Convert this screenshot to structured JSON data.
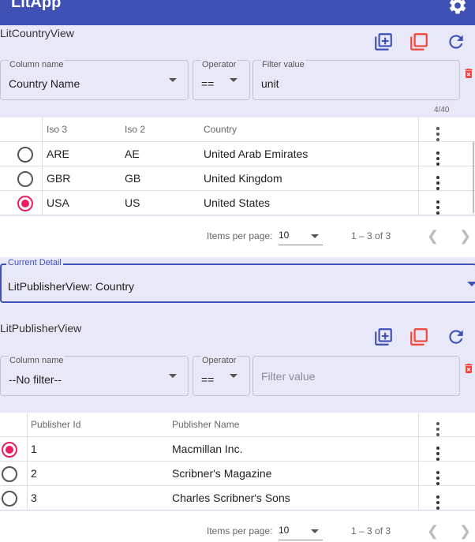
{
  "app": {
    "title": "LitApp"
  },
  "country_view": {
    "title": "LitCountryView",
    "filter": {
      "column_label": "Column name",
      "column_value": "Country Name",
      "operator_label": "Operator",
      "operator_value": "==",
      "value_label": "Filter value",
      "value_value": "unit"
    },
    "count": "4/40",
    "columns": [
      "Iso 3",
      "Iso 2",
      "Country"
    ],
    "rows": [
      {
        "iso3": "ARE",
        "iso2": "AE",
        "country": "United Arab Emirates",
        "selected": false
      },
      {
        "iso3": "GBR",
        "iso2": "GB",
        "country": "United Kingdom",
        "selected": false
      },
      {
        "iso3": "USA",
        "iso2": "US",
        "country": "United States",
        "selected": true
      }
    ],
    "paginator": {
      "items_per_page_label": "Items per page:",
      "items_per_page": "10",
      "range": "1 – 3 of 3"
    }
  },
  "current_detail": {
    "label": "Current Detail",
    "value": "LitPublisherView: Country"
  },
  "publisher_view": {
    "title": "LitPublisherView",
    "filter": {
      "column_label": "Column name",
      "column_value": "--No filter--",
      "operator_label": "Operator",
      "operator_value": "==",
      "value_placeholder": "Filter value"
    },
    "columns": [
      "Publisher Id",
      "Publisher Name"
    ],
    "rows": [
      {
        "id": "1",
        "name": "Macmillan Inc.",
        "selected": true
      },
      {
        "id": "2",
        "name": "Scribner's Magazine",
        "selected": false
      },
      {
        "id": "3",
        "name": "Charles Scribner's Sons",
        "selected": false
      }
    ],
    "paginator": {
      "items_per_page_label": "Items per page:",
      "items_per_page": "10",
      "range": "1 – 3 of 3"
    }
  },
  "colors": {
    "primary": "#3f51b5",
    "accent": "#e91e63",
    "warn": "#f44336",
    "background": "#e8e8f8"
  },
  "icons": [
    "settings-icon",
    "add-to-library-icon",
    "select-all-icon",
    "refresh-icon",
    "delete-filter-icon",
    "more-vert-icon",
    "chevron-left-icon",
    "chevron-right-icon"
  ]
}
